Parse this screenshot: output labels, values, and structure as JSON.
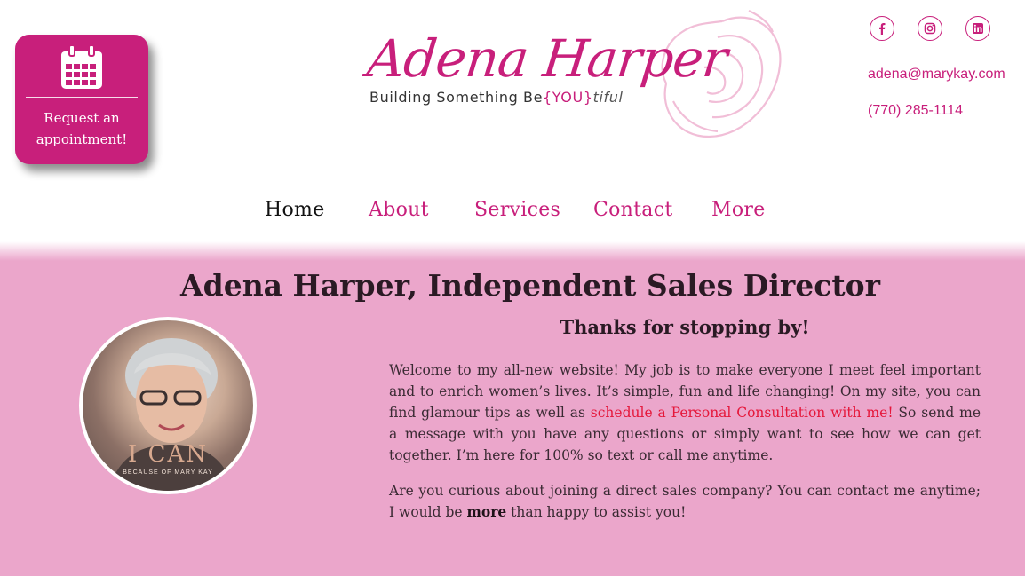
{
  "appointment": {
    "label": "Request an appointment!",
    "icon": "calendar-icon"
  },
  "logo": {
    "name": "Adena Harper",
    "tagline_pre": "Building Something Be",
    "tagline_you": "{YOU}",
    "tagline_post": "tiful"
  },
  "social": [
    {
      "name": "facebook-icon",
      "glyph": "f"
    },
    {
      "name": "instagram-icon",
      "glyph": ""
    },
    {
      "name": "linkedin-icon",
      "glyph": "in"
    }
  ],
  "contact": {
    "email": "adena@marykay.com",
    "phone": "(770) 285-1114"
  },
  "nav": {
    "home": "Home",
    "about": "About",
    "services": "Services",
    "contact": "Contact",
    "more": "More"
  },
  "main": {
    "title": "Adena Harper, Independent Sales Director",
    "subtitle": "Thanks for stopping by!",
    "photo_text_1": "I CAN",
    "photo_text_2": "BECAUSE OF MARY KAY",
    "p1_a": "Welcome to my all-new website! My job is to make everyone I meet feel important and to enrich women’s lives. It’s simple, fun and life changing! On my site, you can find glamour tips as well as ",
    "p1_link": "schedule a Personal Consultation with me!",
    "p1_b": " So send me a message with you have any questions or simply want to see how we can get together. I’m here for 100% so text or call me anytime.",
    "p2_a": "Are you curious about joining a direct sales company? You can contact me anytime; I would be ",
    "p2_bold": "more",
    "p2_b": " than happy to assist you!"
  },
  "colors": {
    "accent": "#c81f7b",
    "main_bg": "#eba6cb",
    "link": "#e5173a"
  }
}
